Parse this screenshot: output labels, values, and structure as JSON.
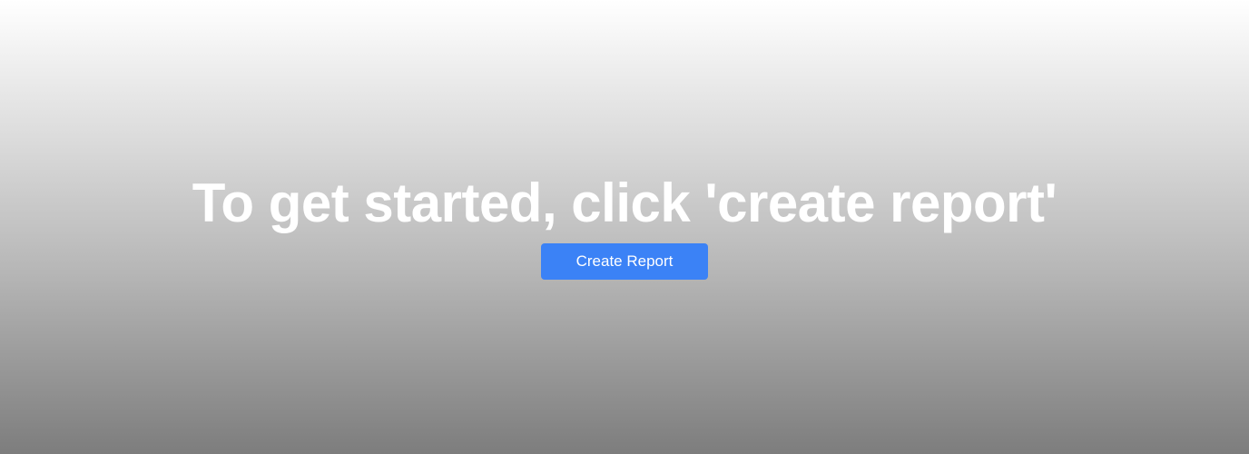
{
  "hero": {
    "headline": "To get started, click 'create report'",
    "button_label": "Create Report"
  },
  "colors": {
    "button_background": "#3b82f6",
    "headline_text": "#ffffff"
  }
}
